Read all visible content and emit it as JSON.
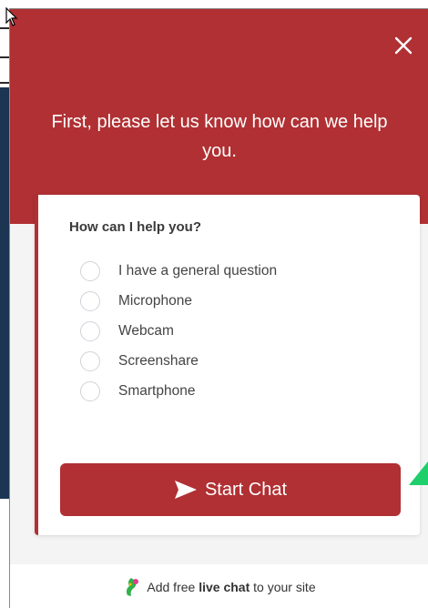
{
  "header": {
    "title": "First, please let us know how can we help you."
  },
  "form": {
    "question": "How can I help you?",
    "options": [
      "I have a general question",
      "Microphone",
      "Webcam",
      "Screenshare",
      "Smartphone"
    ],
    "submit_label": "Start Chat"
  },
  "footer": {
    "prefix": "Add free",
    "link": "live chat",
    "suffix": "to your site"
  },
  "colors": {
    "brand": "#b03033",
    "background": "#f4f4f5",
    "accent_pointer": "#1fcf6b"
  },
  "icons": {
    "close": "close-icon",
    "send": "send-icon",
    "logo": "logo-icon"
  }
}
